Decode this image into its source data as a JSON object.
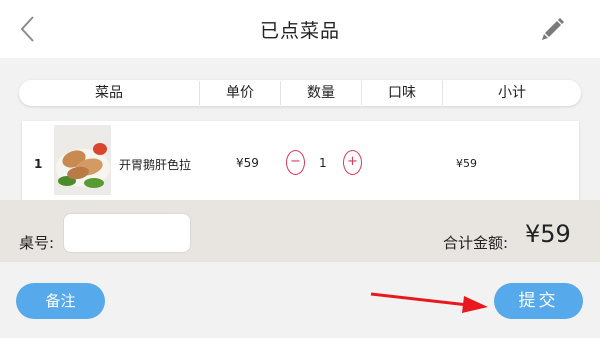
{
  "header": {
    "title": "已点菜品",
    "back_icon": "back-chevron-icon",
    "edit_icon": "edit-pencil-icon"
  },
  "table_header": {
    "columns": [
      "菜品",
      "单价",
      "数量",
      "口味",
      "小计"
    ]
  },
  "items": [
    {
      "index": "1",
      "name": "开胃鹅肝色拉",
      "price": "¥59",
      "quantity": "1",
      "subtotal": "¥59"
    }
  ],
  "stepper": {
    "minus": "−",
    "plus": "+"
  },
  "footer": {
    "table_label": "桌号:",
    "table_input_value": "",
    "total_label": "合计金额:",
    "total_value": "¥59"
  },
  "actions": {
    "note_label": "备注",
    "submit_label": "提交"
  },
  "colors": {
    "button": "#56a9ea",
    "stepper": "#d8385a",
    "arrow": "#e8191e",
    "footer_bg": "#e8e5e1"
  }
}
